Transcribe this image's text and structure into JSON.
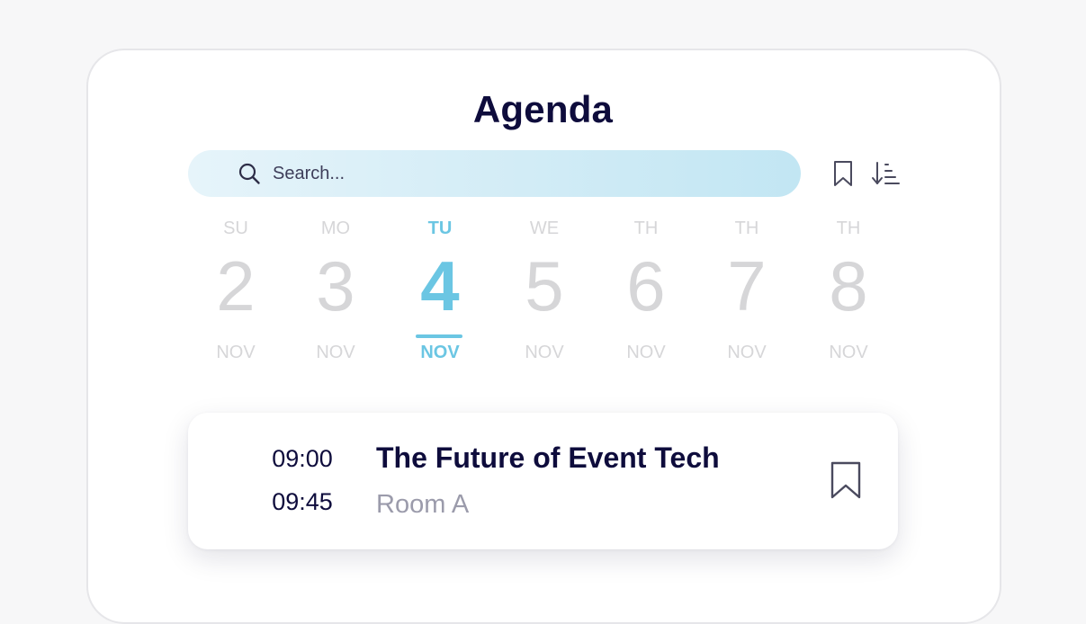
{
  "header": {
    "title": "Agenda"
  },
  "search": {
    "placeholder": "Search...",
    "value": ""
  },
  "toolbar": {
    "bookmark_icon": "bookmark-icon",
    "sort_icon": "sort-descending-icon"
  },
  "days": [
    {
      "dow": "SU",
      "day": "2",
      "month": "NOV",
      "selected": false
    },
    {
      "dow": "MO",
      "day": "3",
      "month": "NOV",
      "selected": false
    },
    {
      "dow": "TU",
      "day": "4",
      "month": "NOV",
      "selected": true
    },
    {
      "dow": "WE",
      "day": "5",
      "month": "NOV",
      "selected": false
    },
    {
      "dow": "TH",
      "day": "6",
      "month": "NOV",
      "selected": false
    },
    {
      "dow": "TH",
      "day": "7",
      "month": "NOV",
      "selected": false
    },
    {
      "dow": "TH",
      "day": "8",
      "month": "NOV",
      "selected": false
    }
  ],
  "sessions": [
    {
      "start": "09:00",
      "end": "09:45",
      "title": "The Future of Event Tech",
      "room": "Room A",
      "bookmarked": false
    }
  ],
  "colors": {
    "accent": "#6bc6e3",
    "text_dark": "#0e0c3c",
    "muted": "#d6d6d8",
    "room": "#9b9bab"
  }
}
